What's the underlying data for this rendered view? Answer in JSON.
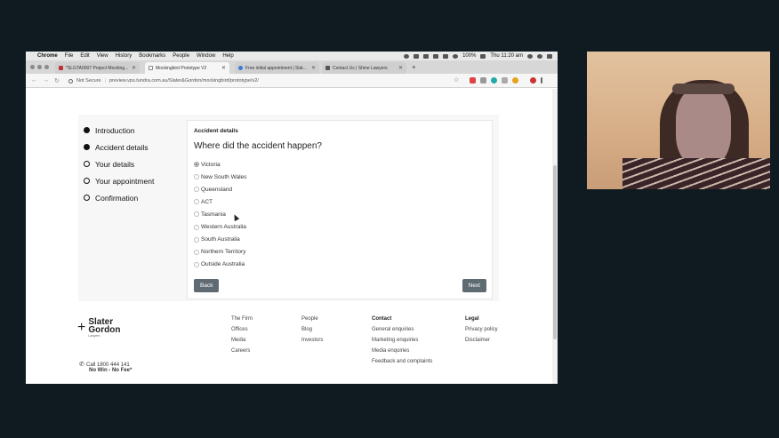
{
  "menubar": {
    "app": "Chrome",
    "items": [
      "File",
      "Edit",
      "View",
      "History",
      "Bookmarks",
      "People",
      "Window",
      "Help"
    ],
    "battery": "100%",
    "clock": "Thu 11:20 am"
  },
  "tabs": [
    {
      "label": "*SLGTA0007 Project Mocking..."
    },
    {
      "label": "Mockingbird Prototype V2"
    },
    {
      "label": "Free initial appointment | Slat..."
    },
    {
      "label": "Contact Us | Shine Lawyers"
    }
  ],
  "address": {
    "security": "Not Secure",
    "url": "preview.vps.tundra.com.au/Slater&Gordon/mockingbird/prototype/v2/"
  },
  "steps": [
    {
      "label": "Introduction",
      "state": "done"
    },
    {
      "label": "Accident details",
      "state": "current"
    },
    {
      "label": "Your details",
      "state": "todo"
    },
    {
      "label": "Your appointment",
      "state": "todo"
    },
    {
      "label": "Confirmation",
      "state": "todo"
    }
  ],
  "form": {
    "section": "Accident details",
    "question": "Where did the accident happen?",
    "options": [
      "Victoria",
      "New South Wales",
      "Queensland",
      "ACT",
      "Tasmania",
      "Western Australia",
      "South Australia",
      "Northern Territory",
      "Outside Australia"
    ],
    "selected": "Victoria",
    "back_label": "Back",
    "next_label": "Next"
  },
  "footer": {
    "logo": {
      "line1": "Slater",
      "line2": "Gordon",
      "tag": "Lawyers"
    },
    "phone": "Call 1800 444 141",
    "nowin": "No Win - No Fee*",
    "col1": [
      "The Firm",
      "Offices",
      "Media",
      "Careers"
    ],
    "col2": [
      "People",
      "Blog",
      "Investors"
    ],
    "contact_heading": "Contact",
    "contact": [
      "General enquiries",
      "Marketing enquiries",
      "Media enquiries",
      "Feedback and complaints"
    ],
    "legal_heading": "Legal",
    "legal": [
      "Privacy policy",
      "Disclaimer"
    ]
  }
}
